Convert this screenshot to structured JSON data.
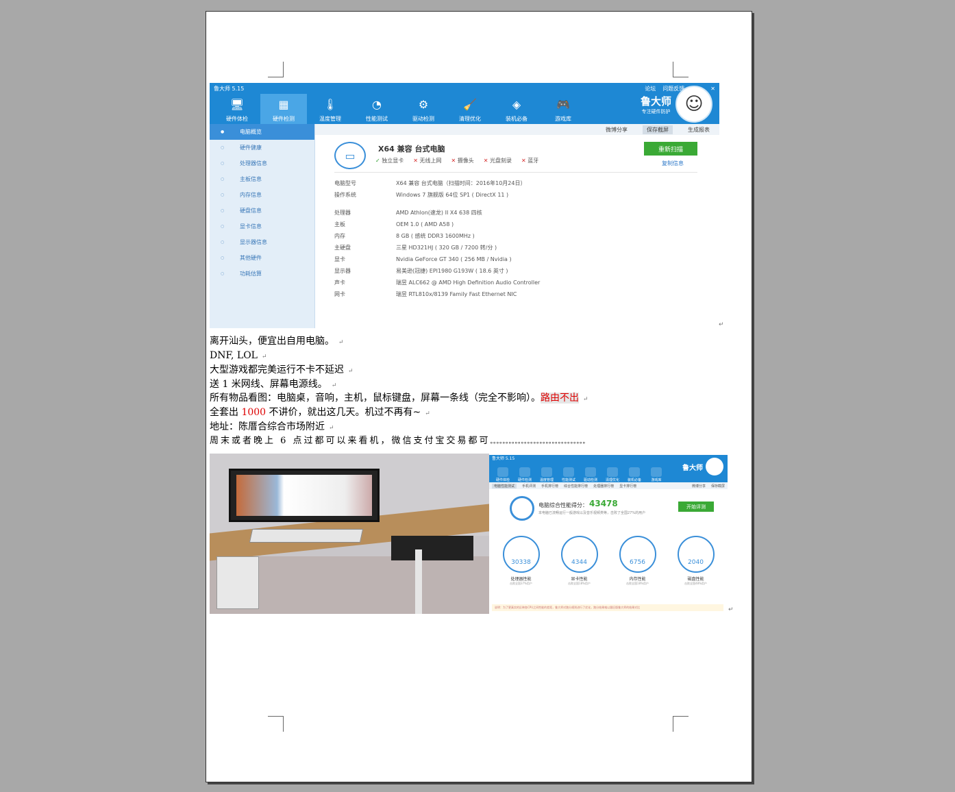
{
  "app": {
    "title": "鲁大师 5.15",
    "topright": [
      "论坛",
      "问题反馈",
      "▾",
      "–",
      "✕"
    ],
    "tools": [
      {
        "label": "硬件体检",
        "icon": "monitor-icon",
        "glyph": "🖥"
      },
      {
        "label": "硬件检测",
        "icon": "board-icon",
        "glyph": "▦"
      },
      {
        "label": "温度管理",
        "icon": "thermometer-icon",
        "glyph": "🌡"
      },
      {
        "label": "性能测试",
        "icon": "gauge-icon",
        "glyph": "◔"
      },
      {
        "label": "驱动检测",
        "icon": "gear-icon",
        "glyph": "⚙"
      },
      {
        "label": "清理优化",
        "icon": "broom-icon",
        "glyph": "🧹"
      },
      {
        "label": "装机必备",
        "icon": "box-icon",
        "glyph": "◈"
      },
      {
        "label": "游戏库",
        "icon": "gamepad-icon",
        "glyph": "🎮"
      }
    ],
    "brand_name": "鲁大师",
    "brand_slogan": "专注硬件防护",
    "sidebar": [
      "电脑概览",
      "硬件健康",
      "处理器信息",
      "主板信息",
      "内存信息",
      "硬盘信息",
      "显卡信息",
      "显示器信息",
      "其他硬件",
      "功耗估算"
    ],
    "subbar": [
      "微博分享",
      "保存截屏",
      "生成报表"
    ],
    "pc_name": "X64 兼容 台式电脑",
    "features": [
      {
        "mark": "✓",
        "label": "独立显卡"
      },
      {
        "mark": "✕",
        "label": "无线上网"
      },
      {
        "mark": "✕",
        "label": "摄像头"
      },
      {
        "mark": "✕",
        "label": "光盘刻录"
      },
      {
        "mark": "✕",
        "label": "蓝牙"
      }
    ],
    "rescan": "重新扫描",
    "copy_info": "复制信息",
    "specs_top": [
      {
        "k": "电脑型号",
        "v": "X64 兼容 台式电脑（扫描时间：2016年10月24日）"
      },
      {
        "k": "操作系统",
        "v": "Windows 7 旗舰版 64位 SP1 ( DirectX 11 )"
      }
    ],
    "specs": [
      {
        "k": "处理器",
        "v": "AMD Athlon(速龙) II X4 638 四核"
      },
      {
        "k": "主板",
        "v": "OEM 1.0 ( AMD A58 )"
      },
      {
        "k": "内存",
        "v": "8 GB ( 感统 DDR3 1600MHz )"
      },
      {
        "k": "主硬盘",
        "v": "三星 HD321HJ ( 320 GB / 7200 转/分 )"
      },
      {
        "k": "显卡",
        "v": "Nvidia GeForce GT 340 ( 256 MB / Nvidia )"
      },
      {
        "k": "显示器",
        "v": "易美逊(冠捷) EPI1980 G193W ( 18.6 英寸 )"
      },
      {
        "k": "声卡",
        "v": "瑞昱 ALC662 @ AMD High Definition Audio Controller"
      },
      {
        "k": "网卡",
        "v": "瑞昱 RTL810x/8139 Family Fast Ethernet NIC"
      }
    ]
  },
  "text": {
    "l1": "离开汕头，便宜出自用电脑。",
    "l2": "DNF, LOL",
    "l3": "大型游戏都完美运行不卡不延迟",
    "l4": "送 1 米网线、屏幕电源线。",
    "l5a": "所有物品看图：电脑桌，音响，主机，鼠标键盘，屏幕一条线（完全不影响）。",
    "l5b": "路由不出",
    "l6a": "全套出 ",
    "l6b": "1000",
    "l6c": " 不讲价，就出这几天。机过不再有~",
    "l7": "地址：陈厝合综合市场附近",
    "l8": "周末或者晚上 6 点过都可以来看机，微信支付宝交易都可",
    "l8dots": "。。。。。。。。。。。。。。。。。。。。。。。。。。。。。。。",
    "pilcrow": "↵"
  },
  "bench": {
    "title": "鲁大师 5.15",
    "tools": [
      "硬件体检",
      "硬件检测",
      "温度管理",
      "性能测试",
      "驱动检测",
      "清理优化",
      "装机必备",
      "游戏库"
    ],
    "brand": "鲁大师",
    "tabs": [
      "电脑性能测试",
      "手机评测",
      "手机排行榜",
      "综合性能排行榜",
      "处理器排行榜",
      "显卡排行榜"
    ],
    "tabs_right": [
      "微博分享",
      "保存截屏"
    ],
    "score_label": "电脑综合性能得分：",
    "score": "43478",
    "score_note": "本电脑已流畅运行一般游戏以及音乐视频类等，击败了全国27%的用户",
    "start": "开始评测",
    "cards": [
      {
        "value": "30338",
        "label": "处理器性能",
        "sub": "击败全国37%用户"
      },
      {
        "value": "4344",
        "label": "显卡性能",
        "sub": "击败全国18%用户"
      },
      {
        "value": "6756",
        "label": "内存性能",
        "sub": "击败全国18%用户"
      },
      {
        "value": "2040",
        "label": "磁盘性能",
        "sub": "击败全国48%用户"
      }
    ],
    "note": "说明：为了更真实的反映各CPU之间性能的差距，鲁大师对跑分规则进行了优化，跑分结果难以跟旧版鲁大师的结果对比"
  }
}
